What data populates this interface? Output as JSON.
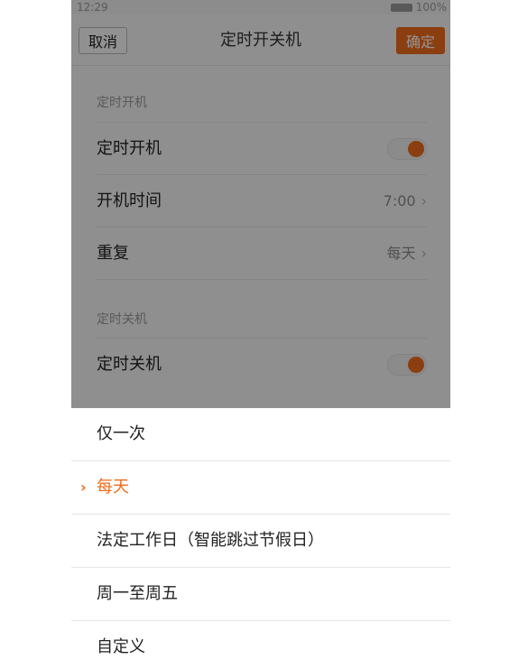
{
  "status_bar": {
    "time": "12:29",
    "battery": "100%"
  },
  "title_bar": {
    "cancel_label": "取消",
    "title": "定时开关机",
    "ok_label": "确定"
  },
  "power_on_section": {
    "header": "定时开机",
    "toggle_label": "定时开机",
    "toggle_on": true,
    "time_label": "开机时间",
    "time_value": "7:00",
    "repeat_label": "重复",
    "repeat_value": "每天"
  },
  "power_off_section": {
    "header": "定时关机",
    "toggle_label": "定时关机",
    "toggle_on": true
  },
  "repeat_sheet": {
    "options": [
      {
        "label": "仅一次",
        "selected": false
      },
      {
        "label": "每天",
        "selected": true
      },
      {
        "label": "法定工作日（智能跳过节假日）",
        "selected": false
      },
      {
        "label": "周一至周五",
        "selected": false
      },
      {
        "label": "自定义",
        "selected": false
      }
    ]
  },
  "colors": {
    "accent": "#ef6b1b",
    "overlay": "rgba(0,0,0,0.42)"
  },
  "icons": {
    "chevron": "chevron-right-icon",
    "check": "chevron-right-icon",
    "battery": "battery-icon"
  }
}
